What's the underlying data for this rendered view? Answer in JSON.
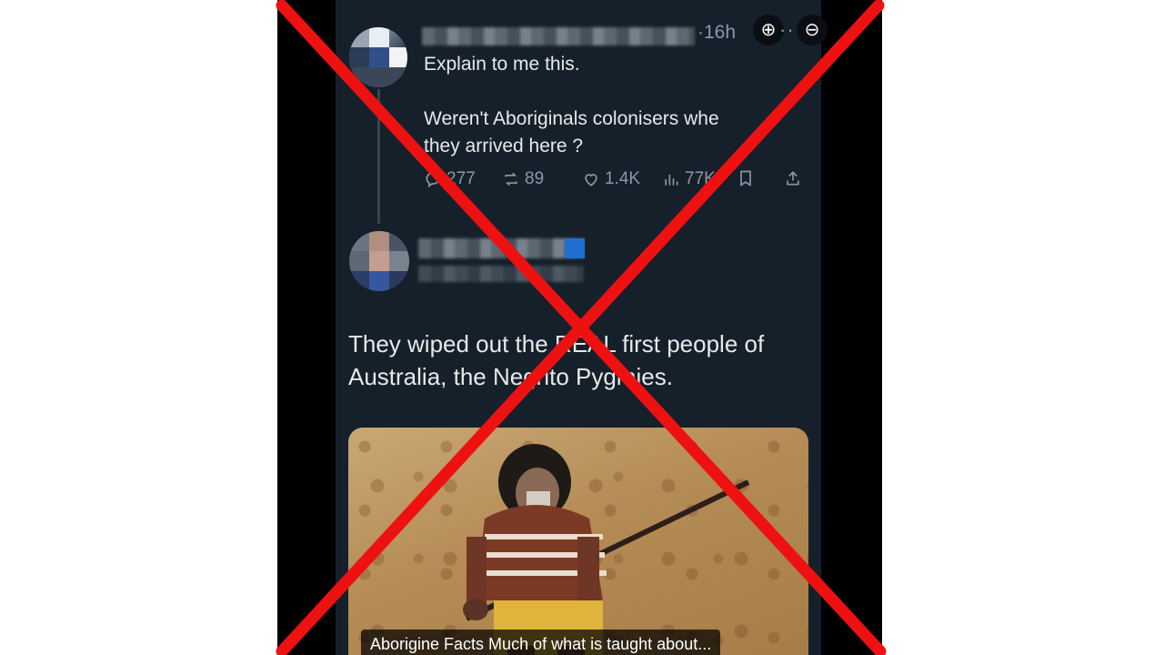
{
  "tweet": {
    "time": "·16h",
    "text": "Explain to me this.\n\nWeren't Aboriginals colonisers whe\nthey arrived here ?",
    "stats": {
      "replies": "277",
      "reposts": "89",
      "likes": "1.4K",
      "views": "77K"
    }
  },
  "reply": {
    "text": "They wiped out the REAL first people of\nAustralia, the Negrito Pygmies."
  },
  "media": {
    "caption": "Aborigine Facts Much of what is taught about..."
  },
  "overlay": {
    "cross_color": "#ee1111"
  }
}
